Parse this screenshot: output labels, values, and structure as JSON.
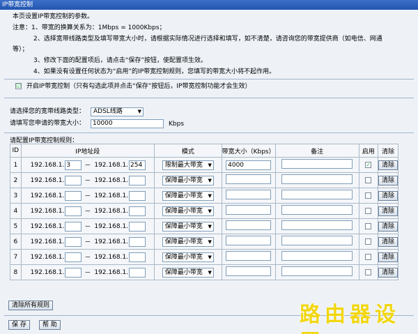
{
  "window": {
    "title": "IP带宽控制"
  },
  "intro": {
    "line1": "本页设置IP带宽控制的参数。",
    "line2": "注意：1、带宽的换算关系为：1Mbps = 1000Kbps；",
    "line3": "2、选择宽带线路类型及填写带宽大小时，请根据实际情况进行选择和填写，如不清楚，请咨询您的带宽提供商（如电信、网通",
    "line3b": "等）；",
    "line4": "3、修改下面的配置项后，请点击“保存”按钮，使配置项生效。",
    "line5": "4、如果没有设置任何状态为“启用”的IP带宽控制规则，您填写的带宽大小将不起作用。"
  },
  "enable": {
    "label": "开启IP带宽控制（只有勾选此项并点击“保存”按钮后，IP带宽控制功能才会生效）",
    "checked": "☑"
  },
  "line_type": {
    "label": "请选择您的宽带线路类型：",
    "value": "ADSL线路"
  },
  "bandwidth": {
    "label": "请填写您申请的带宽大小：",
    "value": "10000",
    "unit": "Kbps"
  },
  "rules_label": "请配置IP带宽控制规则：",
  "table": {
    "headers": [
      "ID",
      "IP地址段",
      "模式",
      "带宽大小（Kbps）",
      "备注",
      "启用",
      "清除"
    ],
    "ip_prefix": "192.168.1.",
    "ip_sep": "－",
    "clear_label": "清除",
    "rows": [
      {
        "id": "1",
        "ip_start": "3",
        "ip_end": "254",
        "mode": "限制最大带宽",
        "bw": "4000",
        "enabled": "✓"
      },
      {
        "id": "2",
        "ip_start": "",
        "ip_end": "",
        "mode": "保障最小带宽",
        "bw": "",
        "enabled": ""
      },
      {
        "id": "3",
        "ip_start": "",
        "ip_end": "",
        "mode": "保障最小带宽",
        "bw": "",
        "enabled": ""
      },
      {
        "id": "4",
        "ip_start": "",
        "ip_end": "",
        "mode": "保障最小带宽",
        "bw": "",
        "enabled": ""
      },
      {
        "id": "5",
        "ip_start": "",
        "ip_end": "",
        "mode": "保障最小带宽",
        "bw": "",
        "enabled": ""
      },
      {
        "id": "6",
        "ip_start": "",
        "ip_end": "",
        "mode": "保障最小带宽",
        "bw": "",
        "enabled": ""
      },
      {
        "id": "7",
        "ip_start": "",
        "ip_end": "",
        "mode": "保障最小带宽",
        "bw": "",
        "enabled": ""
      },
      {
        "id": "8",
        "ip_start": "",
        "ip_end": "",
        "mode": "保障最小带宽",
        "bw": "",
        "enabled": ""
      }
    ]
  },
  "buttons": {
    "clear_all": "清除所有规则",
    "save": "保 存",
    "help": "帮 助"
  },
  "watermark": "路由器设置"
}
